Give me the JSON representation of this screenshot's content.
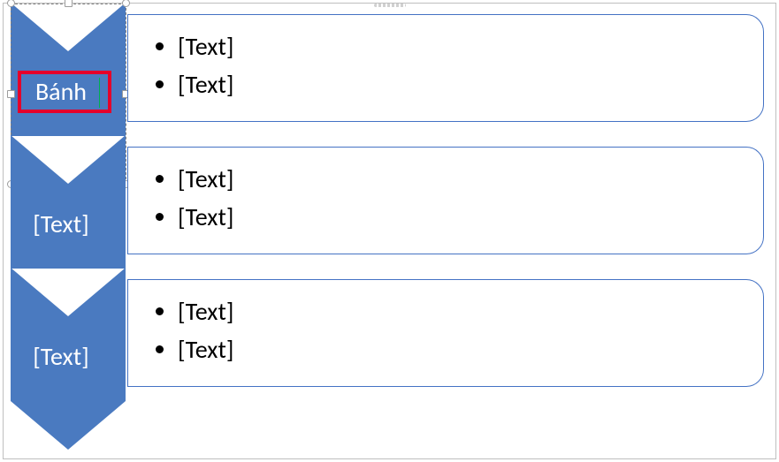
{
  "colors": {
    "shape_fill": "#4a7ac0",
    "shape_stroke": "#4472c4",
    "highlight": "#e4002b"
  },
  "rows": [
    {
      "chevron_label": "Bánh",
      "bullets": [
        "[Text]",
        "[Text]"
      ],
      "selected": true,
      "highlighted": true
    },
    {
      "chevron_label": "[Text]",
      "bullets": [
        "[Text]",
        "[Text]"
      ],
      "selected": false,
      "highlighted": false
    },
    {
      "chevron_label": "[Text]",
      "bullets": [
        "[Text]",
        "[Text]"
      ],
      "selected": false,
      "highlighted": false
    }
  ]
}
